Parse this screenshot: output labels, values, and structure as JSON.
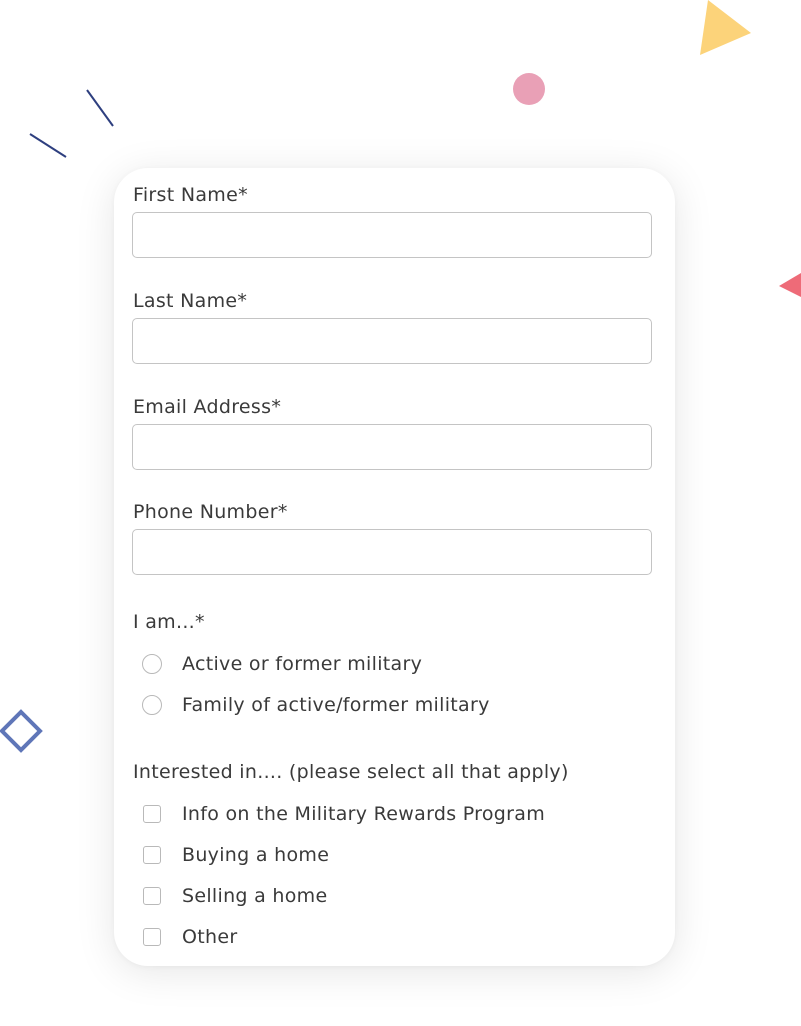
{
  "form": {
    "first_name": {
      "label": "First Name*",
      "value": "",
      "placeholder": ""
    },
    "last_name": {
      "label": "Last Name*",
      "value": "",
      "placeholder": ""
    },
    "email": {
      "label": "Email Address*",
      "value": "",
      "placeholder": ""
    },
    "phone": {
      "label": "Phone Number*",
      "value": "",
      "placeholder": ""
    },
    "i_am": {
      "label": "I am...*",
      "options": [
        {
          "label": "Active or former military",
          "selected": false
        },
        {
          "label": "Family of active/former military",
          "selected": false
        }
      ]
    },
    "interested_in": {
      "label": "Interested in.... (please select all that apply)",
      "options": [
        {
          "label": "Info on the Military Rewards Program",
          "checked": false
        },
        {
          "label": "Buying a home",
          "checked": false
        },
        {
          "label": "Selling a home",
          "checked": false
        },
        {
          "label": "Other",
          "checked": false
        }
      ]
    }
  },
  "decorations": {
    "line_color": "#2e3f7f",
    "dot_color": "#e9a0b6",
    "yellow_triangle_color": "#fcd37a",
    "red_triangle_color": "#ee6b78",
    "diamond_color": "#5f76b8"
  }
}
